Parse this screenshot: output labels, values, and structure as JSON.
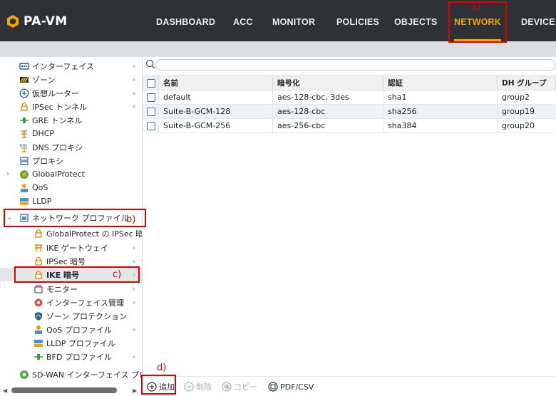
{
  "app": {
    "logo_text": "PA-VM"
  },
  "nav": {
    "tabs": [
      {
        "label": "DASHBOARD"
      },
      {
        "label": "ACC"
      },
      {
        "label": "MONITOR"
      },
      {
        "label": "POLICIES"
      },
      {
        "label": "OBJECTS"
      },
      {
        "label": "NETWORK",
        "active": true
      },
      {
        "label": "DEVICE"
      }
    ]
  },
  "sidebar": {
    "items": [
      {
        "label": "インターフェイス",
        "icon": "interface-icon"
      },
      {
        "label": "ゾーン",
        "icon": "zone-icon"
      },
      {
        "label": "仮想ルーター",
        "icon": "virtual-router-icon"
      },
      {
        "label": "IPSec トンネル",
        "icon": "ipsec-tunnel-icon"
      },
      {
        "label": "GRE トンネル",
        "icon": "gre-tunnel-icon"
      },
      {
        "label": "DHCP",
        "icon": "dhcp-icon"
      },
      {
        "label": "DNS プロキシ",
        "icon": "dns-proxy-icon"
      },
      {
        "label": "プロキシ",
        "icon": "proxy-icon"
      },
      {
        "label": "GlobalProtect",
        "icon": "globalprotect-icon"
      },
      {
        "label": "QoS",
        "icon": "qos-icon"
      },
      {
        "label": "LLDP",
        "icon": "lldp-icon"
      },
      {
        "label": "ネットワーク プロファイル",
        "icon": "network-profile-icon"
      },
      {
        "label": "GlobalProtect の IPSec 暗号",
        "icon": "lock-icon"
      },
      {
        "label": "IKE ゲートウェイ",
        "icon": "ike-gateway-icon"
      },
      {
        "label": "IPSec 暗号",
        "icon": "lock-icon"
      },
      {
        "label": "IKE 暗号",
        "icon": "lock-icon",
        "selected": true
      },
      {
        "label": "モニター",
        "icon": "monitor-icon"
      },
      {
        "label": "インターフェイス管理",
        "icon": "interface-mgmt-icon"
      },
      {
        "label": "ゾーン プロテクション",
        "icon": "zone-protection-icon"
      },
      {
        "label": "QoS プロファイル",
        "icon": "qos-profile-icon"
      },
      {
        "label": "LLDP プロファイル",
        "icon": "lldp-profile-icon"
      },
      {
        "label": "BFD プロファイル",
        "icon": "bfd-profile-icon"
      },
      {
        "label": "SD-WAN インターフェイス プロファイル",
        "icon": "sdwan-icon"
      }
    ]
  },
  "table": {
    "columns": [
      "名前",
      "暗号化",
      "認証",
      "DH グループ"
    ],
    "rows": [
      [
        "default",
        "aes-128-cbc, 3des",
        "sha1",
        "group2"
      ],
      [
        "Suite-B-GCM-128",
        "aes-128-cbc",
        "sha256",
        "group19"
      ],
      [
        "Suite-B-GCM-256",
        "aes-256-cbc",
        "sha384",
        "group20"
      ]
    ]
  },
  "actions": {
    "add": "追加",
    "delete": "削除",
    "copy": "コピー",
    "pdf": "PDF/CSV"
  },
  "annotations": {
    "a": "a)",
    "b": "b)",
    "c": "c)",
    "d": "d)"
  },
  "colors": {
    "header_bg": "#2e3234",
    "accent": "#f6a500",
    "link": "#1d6ab6",
    "annotation": "#e00000"
  }
}
